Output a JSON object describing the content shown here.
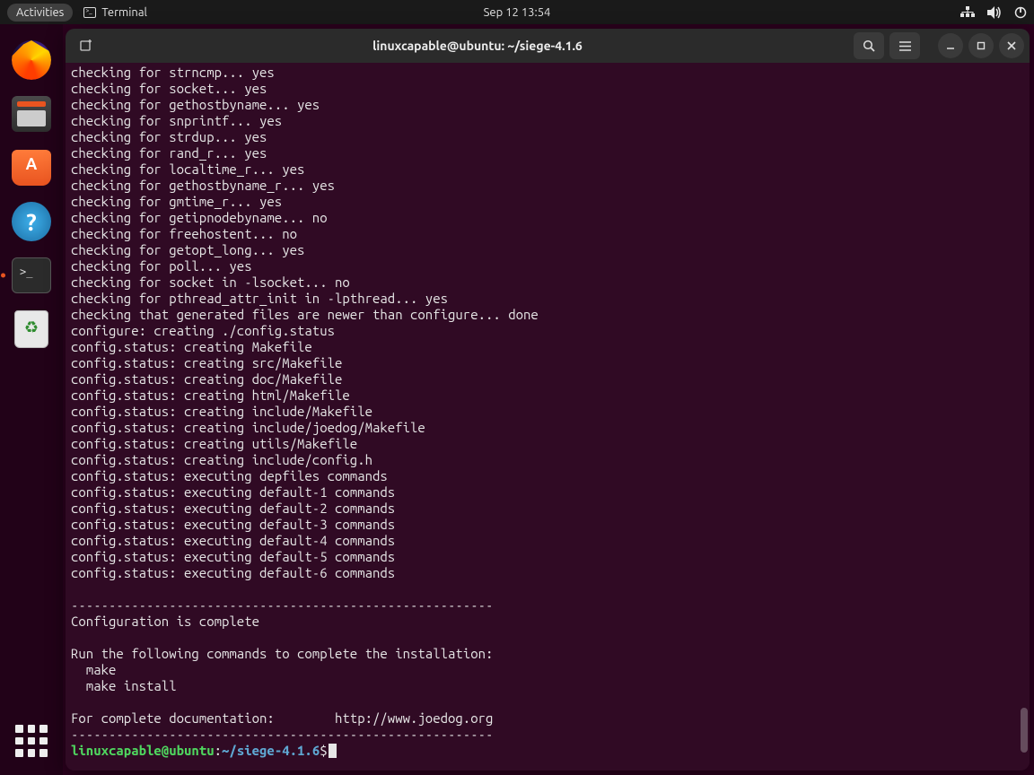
{
  "topbar": {
    "activities": "Activities",
    "app_name": "Terminal",
    "clock": "Sep 12  13:54"
  },
  "dock": {
    "items": [
      {
        "name": "firefox"
      },
      {
        "name": "files"
      },
      {
        "name": "software"
      },
      {
        "name": "help"
      },
      {
        "name": "terminal",
        "active": true
      },
      {
        "name": "trash"
      }
    ]
  },
  "window": {
    "title": "linuxcapable@ubuntu: ~/siege-4.1.6"
  },
  "terminal": {
    "lines": [
      "checking for strncmp... yes",
      "checking for socket... yes",
      "checking for gethostbyname... yes",
      "checking for snprintf... yes",
      "checking for strdup... yes",
      "checking for rand_r... yes",
      "checking for localtime_r... yes",
      "checking for gethostbyname_r... yes",
      "checking for gmtime_r... yes",
      "checking for getipnodebyname... no",
      "checking for freehostent... no",
      "checking for getopt_long... yes",
      "checking for poll... yes",
      "checking for socket in -lsocket... no",
      "checking for pthread_attr_init in -lpthread... yes",
      "checking that generated files are newer than configure... done",
      "configure: creating ./config.status",
      "config.status: creating Makefile",
      "config.status: creating src/Makefile",
      "config.status: creating doc/Makefile",
      "config.status: creating html/Makefile",
      "config.status: creating include/Makefile",
      "config.status: creating include/joedog/Makefile",
      "config.status: creating utils/Makefile",
      "config.status: creating include/config.h",
      "config.status: executing depfiles commands",
      "config.status: executing default-1 commands",
      "config.status: executing default-2 commands",
      "config.status: executing default-3 commands",
      "config.status: executing default-4 commands",
      "config.status: executing default-5 commands",
      "config.status: executing default-6 commands",
      "",
      "--------------------------------------------------------",
      "Configuration is complete",
      "",
      "Run the following commands to complete the installation:",
      "  make",
      "  make install",
      "",
      "For complete documentation:        http://www.joedog.org",
      "--------------------------------------------------------"
    ],
    "prompt": {
      "user_host": "linuxcapable@ubuntu",
      "colon": ":",
      "path": "~/siege-4.1.6",
      "dollar": "$"
    }
  }
}
